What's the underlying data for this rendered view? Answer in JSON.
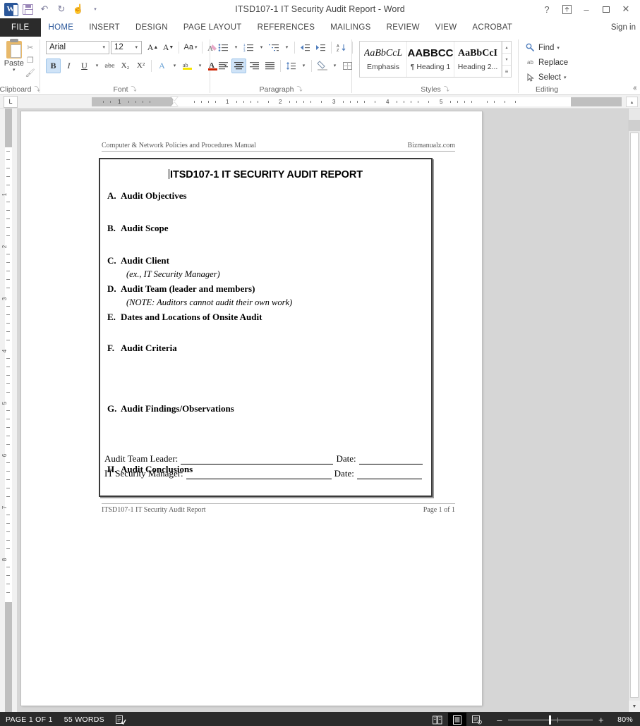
{
  "titlebar": {
    "title": "ITSD107-1 IT Security Audit Report - Word",
    "quick_access": [
      {
        "name": "word-logo-icon",
        "label": "W"
      },
      {
        "name": "save-icon",
        "label": ""
      },
      {
        "name": "undo-icon",
        "label": "↶"
      },
      {
        "name": "redo-icon",
        "label": "↻"
      },
      {
        "name": "touch-mode-icon",
        "label": "☝"
      },
      {
        "name": "customize-qat-icon",
        "label": "▾"
      }
    ],
    "window_controls": {
      "help": "?",
      "ribbon_display": "⬆",
      "minimize": "–",
      "restore": "❐",
      "close": "✕"
    }
  },
  "tabs": [
    {
      "label": "FILE",
      "active": false,
      "file": true
    },
    {
      "label": "HOME",
      "active": true
    },
    {
      "label": "INSERT",
      "active": false
    },
    {
      "label": "DESIGN",
      "active": false
    },
    {
      "label": "PAGE LAYOUT",
      "active": false
    },
    {
      "label": "REFERENCES",
      "active": false
    },
    {
      "label": "MAILINGS",
      "active": false
    },
    {
      "label": "REVIEW",
      "active": false
    },
    {
      "label": "VIEW",
      "active": false
    },
    {
      "label": "ACROBAT",
      "active": false
    }
  ],
  "signin": "Sign in",
  "ribbon": {
    "clipboard": {
      "label": "Clipboard",
      "paste_label": "Paste",
      "paste_caret": "▾",
      "cut_icon": "✂",
      "copy_icon": "❐",
      "format_painter_icon": "🖌"
    },
    "font": {
      "label": "Font",
      "font_name": "Arial",
      "font_size": "12",
      "grow_font": "A",
      "shrink_font": "A",
      "change_case": "Aa",
      "clear_formatting": "A",
      "bold": "B",
      "italic": "I",
      "underline": "U",
      "strikethrough": "abc",
      "subscript": "X₂",
      "superscript": "X²",
      "text_effects": "A",
      "highlight": "ab",
      "font_color": "A",
      "bold_active": true
    },
    "paragraph": {
      "label": "Paragraph",
      "bullets": "≣",
      "numbering": "≣",
      "multilevel": "≣",
      "decrease_indent": "⇤",
      "increase_indent": "⇥",
      "sort": "A↓",
      "show_marks": "¶",
      "align_left": "≡",
      "align_center": "≡",
      "align_right": "≡",
      "justify": "≡",
      "line_spacing": "↕",
      "shading": "△",
      "borders": "⊞",
      "align_center_active": true
    },
    "styles": {
      "label": "Styles",
      "items": [
        {
          "preview": "AaBbCcL",
          "name": "Emphasis"
        },
        {
          "preview": "AABBCC",
          "name": "¶ Heading 1"
        },
        {
          "preview": "AaBbCcI",
          "name": "Heading 2..."
        }
      ],
      "scroll_up": "▴",
      "scroll_down": "▾",
      "more": "≡"
    },
    "editing": {
      "label": "Editing",
      "items": [
        {
          "label": "Find",
          "icon": "🔍",
          "caret": "▾"
        },
        {
          "label": "Replace",
          "icon": "ab",
          "caret": ""
        },
        {
          "label": "Select",
          "icon": "➤",
          "caret": "▾"
        }
      ]
    },
    "collapse_ribbon": "ⱏ",
    "dialog_launcher": "⤵"
  },
  "ruler": {
    "tab_selector": "L",
    "h_marks": [
      "1",
      "1",
      "2",
      "3",
      "4",
      "5"
    ],
    "v_marks": [
      "1",
      "2",
      "3",
      "4",
      "5",
      "6",
      "7",
      "8"
    ],
    "scroll_up": "▴"
  },
  "document": {
    "header_left": "Computer & Network Policies and Procedures Manual",
    "header_right": "Bizmanualz.com",
    "form_title": "ITSD107-1   IT SECURITY AUDIT REPORT",
    "items": [
      {
        "letter": "A.",
        "text": "Audit Objectives",
        "note": ""
      },
      {
        "letter": "B.",
        "text": "Audit Scope",
        "note": ""
      },
      {
        "letter": "C.",
        "text": "Audit Client",
        "note": "(ex., IT Security Manager)"
      },
      {
        "letter": "D.",
        "text": "Audit Team (leader and members)",
        "note": "(NOTE: Auditors cannot audit their own work)"
      },
      {
        "letter": "E.",
        "text": "Dates and Locations of Onsite Audit",
        "note": ""
      },
      {
        "letter": "F.",
        "text": "Audit Criteria",
        "note": ""
      },
      {
        "letter": "G.",
        "text": "Audit Findings/Observations",
        "note": ""
      },
      {
        "letter": "H.",
        "text": "Audit Conclusions",
        "note": ""
      }
    ],
    "signatures": [
      {
        "label": "Audit Team Leader:",
        "date_label": "Date:"
      },
      {
        "label": "IT Security Manager:",
        "date_label": "Date:"
      }
    ],
    "footer_left": "ITSD107-1 IT Security Audit Report",
    "footer_right": "Page 1 of 1"
  },
  "statusbar": {
    "page": "PAGE 1 OF 1",
    "words": "55 WORDS",
    "proofing_icon": "proofing-errors-icon",
    "views": [
      {
        "name": "read-mode-view-button",
        "glyph": "⌸",
        "selected": false
      },
      {
        "name": "print-layout-view-button",
        "glyph": "▤",
        "selected": true
      },
      {
        "name": "web-layout-view-button",
        "glyph": "⌗",
        "selected": false
      }
    ],
    "zoom_out": "–",
    "zoom_in": "+",
    "zoom_value": "80%"
  }
}
